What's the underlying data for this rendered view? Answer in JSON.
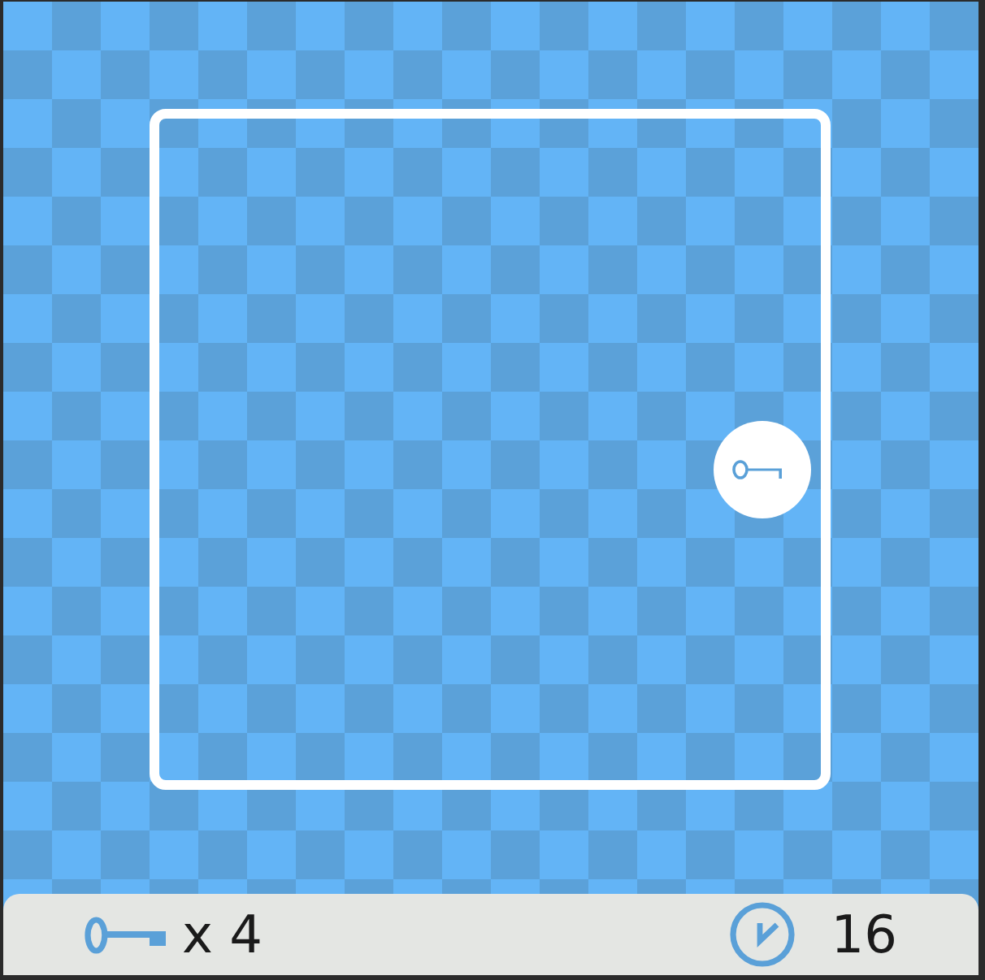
{
  "board": {
    "items": [
      {
        "kind": "key"
      }
    ]
  },
  "status_bar": {
    "keys": {
      "count": "x 4"
    },
    "timer": {
      "value": "16"
    }
  }
}
